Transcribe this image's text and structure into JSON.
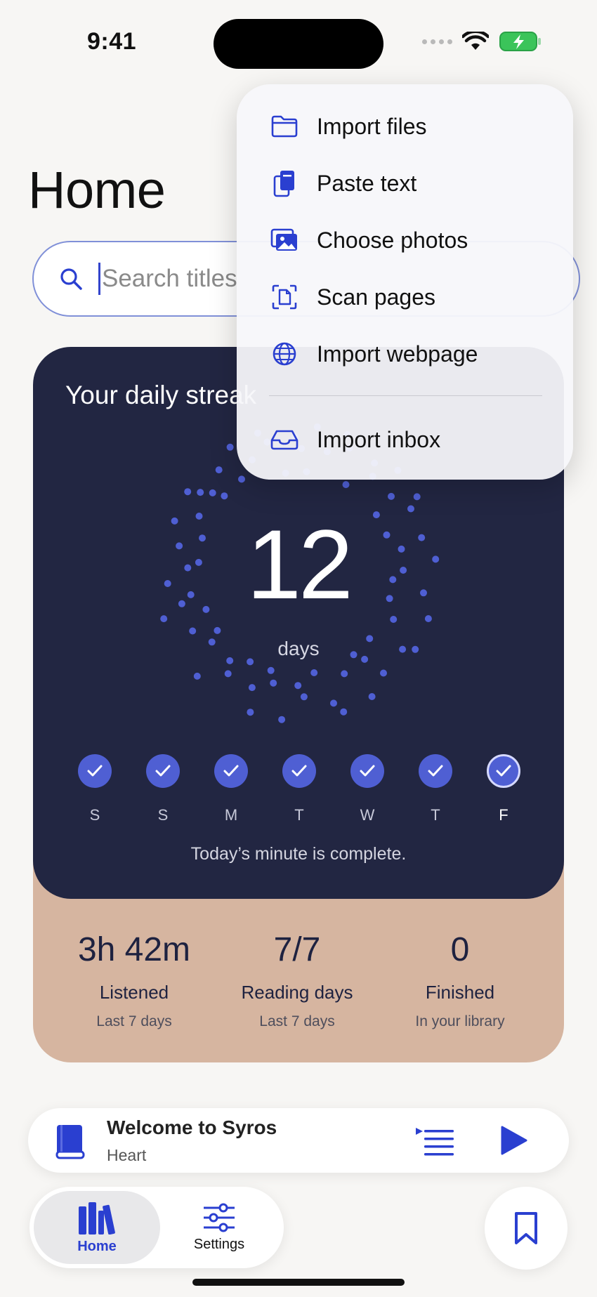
{
  "status_bar": {
    "time": "9:41"
  },
  "page": {
    "title": "Home"
  },
  "search": {
    "placeholder": "Search titles"
  },
  "streak": {
    "title": "Your daily streak",
    "count": "12",
    "unit": "days",
    "days": [
      {
        "label": "S",
        "done": true
      },
      {
        "label": "S",
        "done": true
      },
      {
        "label": "M",
        "done": true
      },
      {
        "label": "T",
        "done": true
      },
      {
        "label": "W",
        "done": true
      },
      {
        "label": "T",
        "done": true
      },
      {
        "label": "F",
        "done": true,
        "today": true
      }
    ],
    "note": "Today’s minute is complete."
  },
  "stats": [
    {
      "value": "3h 42m",
      "label": "Listened",
      "sub": "Last 7 days"
    },
    {
      "value": "7/7",
      "label": "Reading days",
      "sub": "Last 7 days"
    },
    {
      "value": "0",
      "label": "Finished",
      "sub": "In your library"
    }
  ],
  "player": {
    "title": "Welcome to Syros",
    "subtitle": "Heart"
  },
  "tabs": [
    {
      "label": "Home",
      "active": true
    },
    {
      "label": "Settings",
      "active": false
    }
  ],
  "import_menu": {
    "items": [
      {
        "label": "Import files",
        "icon": "folder-icon"
      },
      {
        "label": "Paste text",
        "icon": "paste-icon"
      },
      {
        "label": "Choose photos",
        "icon": "photos-icon"
      },
      {
        "label": "Scan pages",
        "icon": "scan-icon"
      },
      {
        "label": "Import webpage",
        "icon": "globe-icon"
      },
      {
        "label": "Import inbox",
        "icon": "tray-icon"
      }
    ]
  },
  "colors": {
    "accent": "#2a3fd0",
    "streak_bg": "#222642",
    "stats_bg": "#d6b5a0",
    "dot": "#4f5fd3"
  }
}
